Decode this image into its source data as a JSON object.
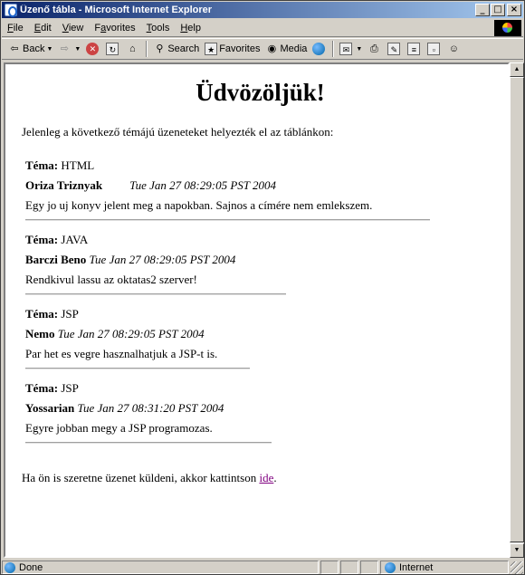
{
  "window": {
    "title": "Üzenő tábla - Microsoft Internet Explorer"
  },
  "window_controls": {
    "minimize": "_",
    "maximize": "□",
    "close": "×"
  },
  "menu": [
    {
      "label_pre": "",
      "accel": "F",
      "label_post": "ile"
    },
    {
      "label_pre": "",
      "accel": "E",
      "label_post": "dit"
    },
    {
      "label_pre": "",
      "accel": "V",
      "label_post": "iew"
    },
    {
      "label_pre": "F",
      "accel": "a",
      "label_post": "vorites"
    },
    {
      "label_pre": "",
      "accel": "T",
      "label_post": "ools"
    },
    {
      "label_pre": "",
      "accel": "H",
      "label_post": "elp"
    }
  ],
  "toolbar": {
    "back": "Back",
    "search": "Search",
    "favorites": "Favorites",
    "media": "Media"
  },
  "page": {
    "heading": "Üdvözöljük!",
    "intro": "Jelenleg a következő témájú üzeneteket helyezték el az táblánkon:",
    "topic_label": "Téma:",
    "messages": [
      {
        "topic": "HTML",
        "author": "Oriza Triznyak",
        "date": "Tue Jan 27 08:29:05 PST 2004",
        "text": "Egy jo uj konyv jelent meg a napokban. Sajnos a címére nem emlekszem."
      },
      {
        "topic": "JAVA",
        "author": "Barczi Beno",
        "date": "Tue Jan 27 08:29:05 PST 2004",
        "text": "Rendkivul lassu az oktatas2 szerver!"
      },
      {
        "topic": "JSP",
        "author": "Nemo",
        "date": "Tue Jan 27 08:29:05 PST 2004",
        "text": "Par het es vegre hasznalhatjuk a JSP-t is."
      },
      {
        "topic": "JSP",
        "author": "Yossarian",
        "date": "Tue Jan 27 08:31:20 PST 2004",
        "text": "Egyre jobban megy a JSP programozas."
      }
    ],
    "footer_text": "Ha ön is szeretne üzenet küldeni, akkor kattintson ",
    "footer_link": "ide",
    "footer_end": "."
  },
  "status": {
    "text": "Done",
    "zone": "Internet"
  }
}
